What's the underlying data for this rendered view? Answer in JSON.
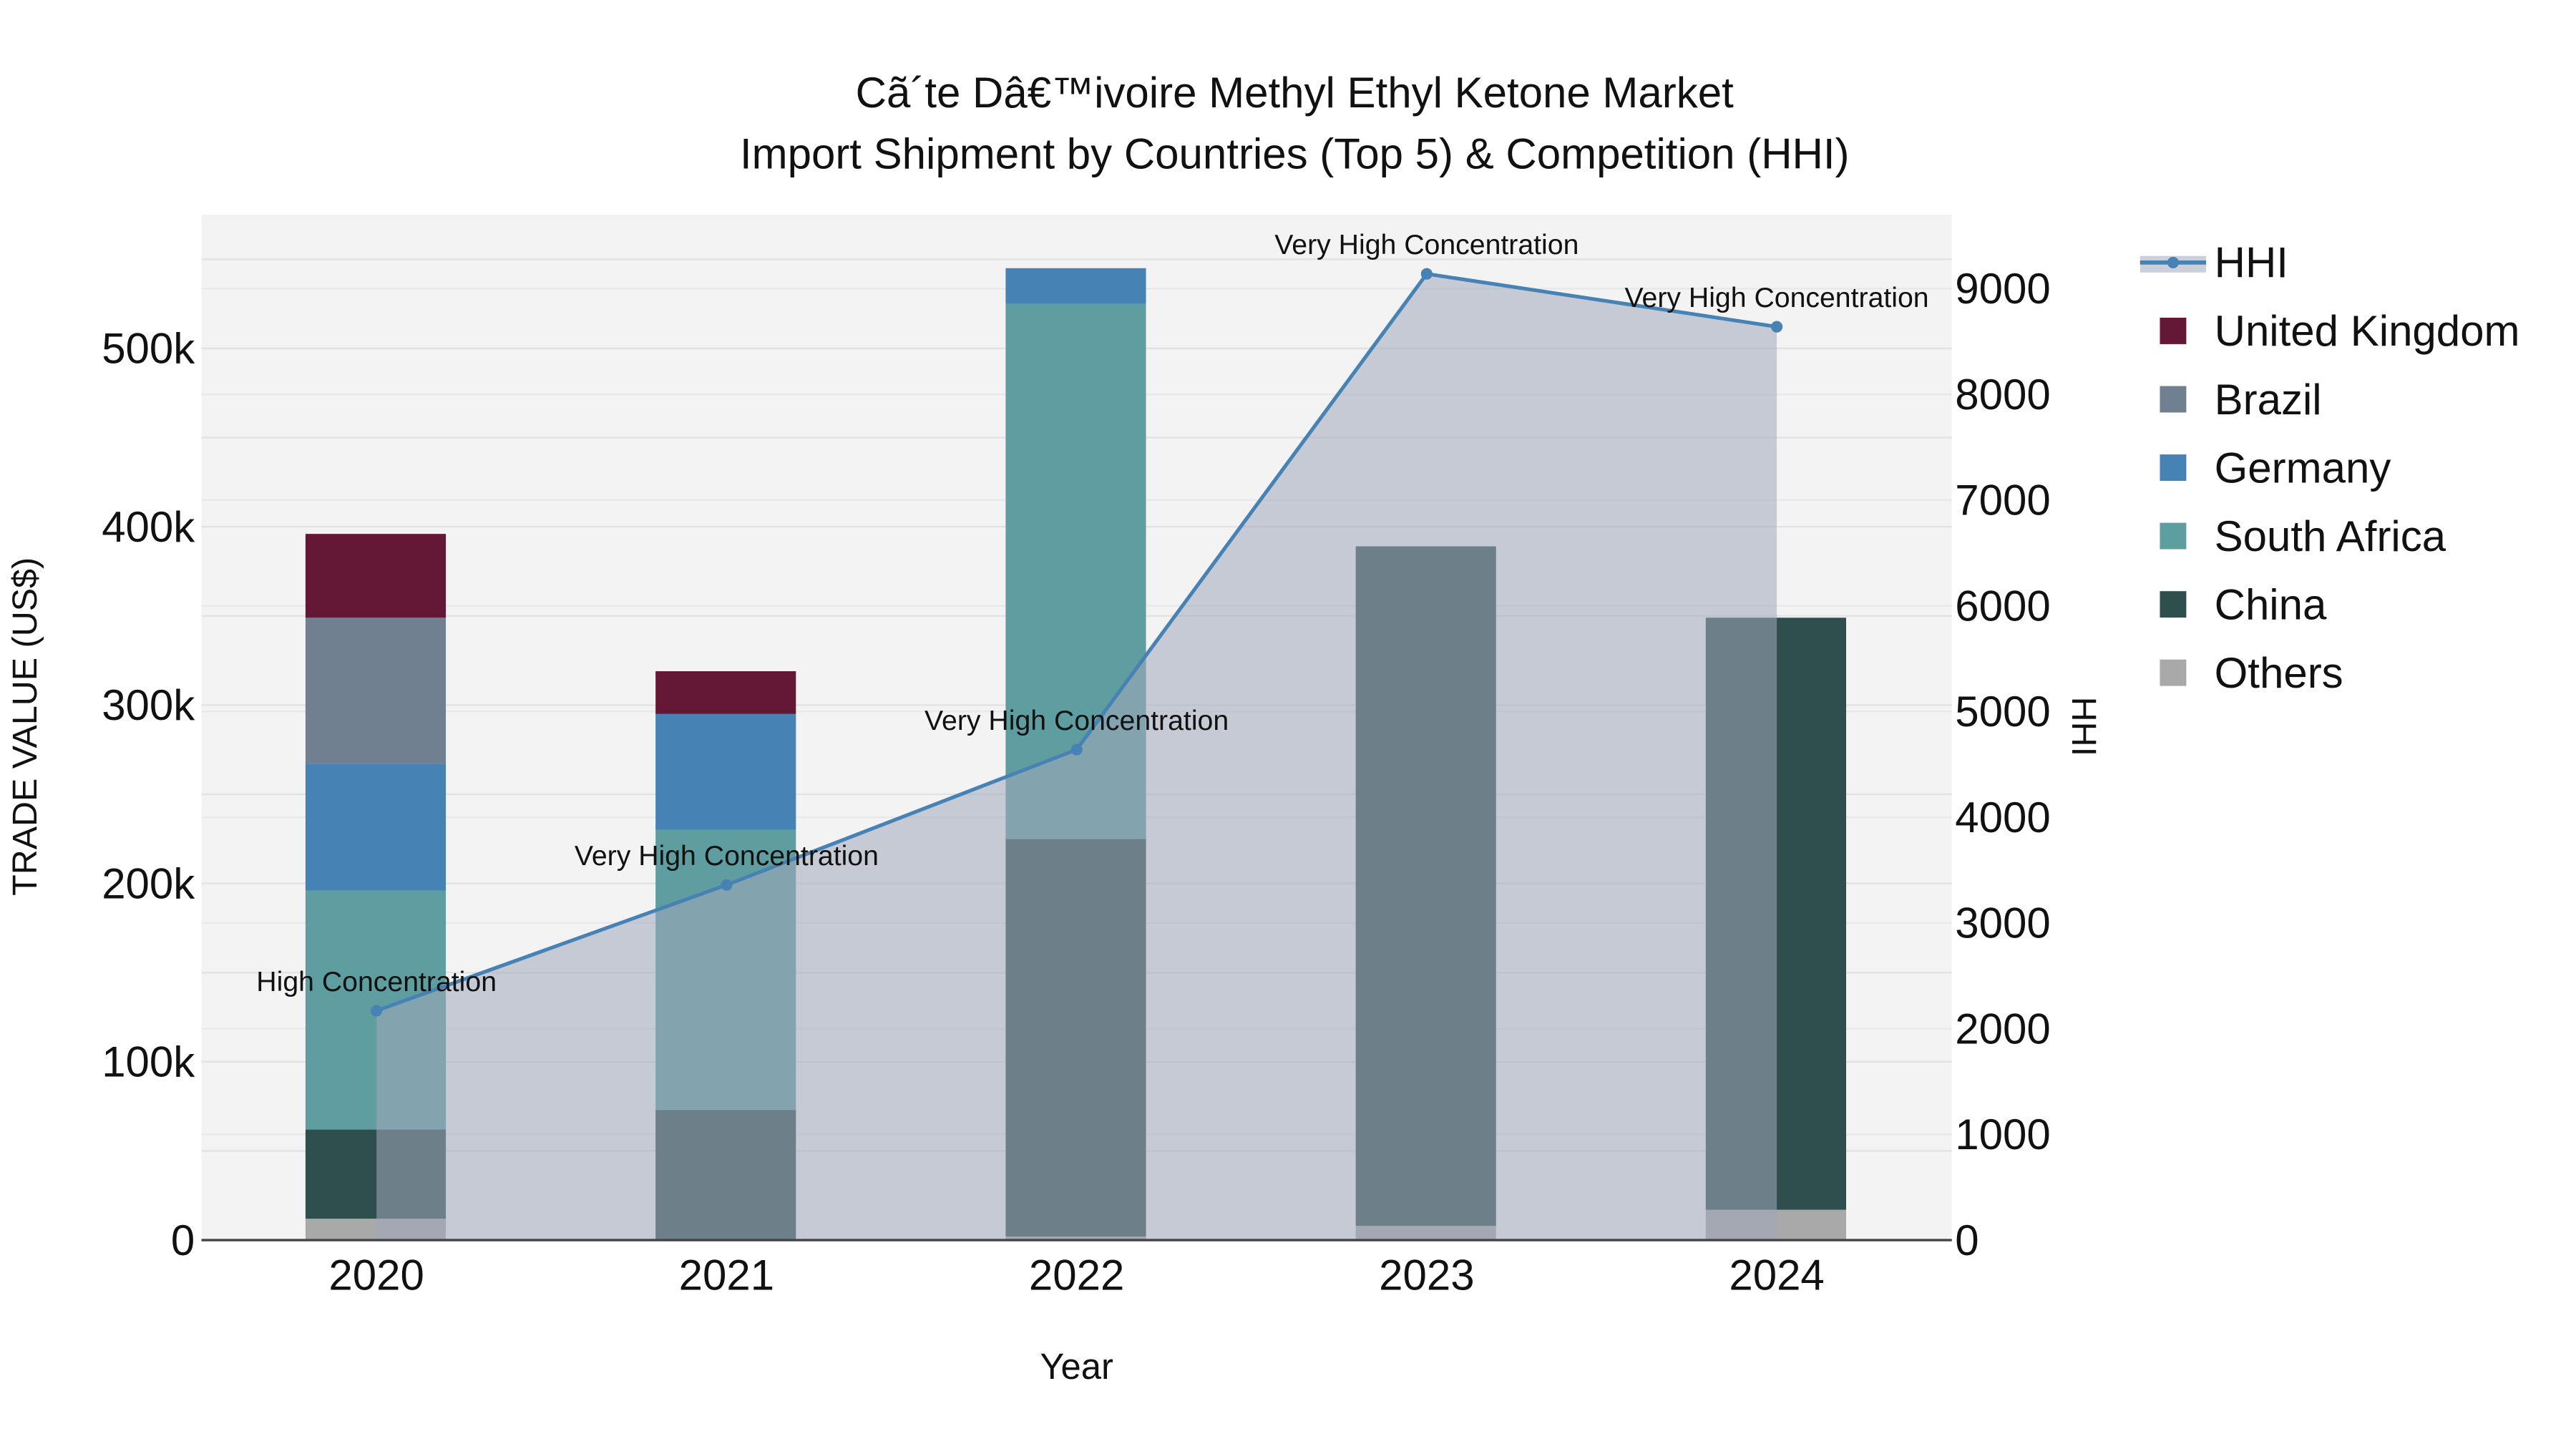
{
  "chart_data": {
    "type": "bar",
    "title": "Cã´te Dâ€™ivoire Methyl Ethyl Ketone Market",
    "subtitle": "Import Shipment by Countries (Top 5) & Competition (HHI)",
    "xlabel": "Year",
    "ylabel": "TRADE VALUE (US$)",
    "y2label": "HHI",
    "categories": [
      "2020",
      "2021",
      "2022",
      "2023",
      "2024"
    ],
    "ylim": [
      0,
      575000
    ],
    "y2lim": [
      0,
      9700
    ],
    "yticks": [
      0,
      100000,
      200000,
      300000,
      400000,
      500000
    ],
    "ytick_labels": [
      "0",
      "100k",
      "200k",
      "300k",
      "400k",
      "500k"
    ],
    "y2ticks": [
      0,
      1000,
      2000,
      3000,
      4000,
      5000,
      6000,
      7000,
      8000,
      9000
    ],
    "y2tick_labels": [
      "0",
      "1000",
      "2000",
      "3000",
      "4000",
      "5000",
      "6000",
      "7000",
      "8000",
      "9000"
    ],
    "stacked": true,
    "series": [
      {
        "name": "Others",
        "color": "#a9a9a9",
        "values": [
          12000,
          0,
          2000,
          8000,
          17000
        ]
      },
      {
        "name": "China",
        "color": "#2f4f4f",
        "values": [
          50000,
          73000,
          223000,
          381000,
          332000
        ]
      },
      {
        "name": "South Africa",
        "color": "#5f9ea0",
        "values": [
          134000,
          157000,
          300000,
          0,
          0
        ]
      },
      {
        "name": "Germany",
        "color": "#4682b4",
        "values": [
          71000,
          65000,
          20000,
          0,
          0
        ]
      },
      {
        "name": "Brazil",
        "color": "#708090",
        "values": [
          82000,
          0,
          0,
          0,
          0
        ]
      },
      {
        "name": "United Kingdom",
        "color": "#641835",
        "values": [
          47000,
          24000,
          0,
          0,
          0
        ]
      }
    ],
    "hhi": {
      "name": "HHI",
      "color": "#4682b4",
      "values": [
        2170,
        3360,
        4640,
        9140,
        8640
      ],
      "annotations": [
        "High Concentration",
        "Very High Concentration",
        "Very High Concentration",
        "Very High Concentration",
        "Very High Concentration"
      ]
    },
    "legend": {
      "placement": "right",
      "entries": [
        "HHI",
        "United Kingdom",
        "Brazil",
        "Germany",
        "South Africa",
        "China",
        "Others"
      ]
    },
    "grid": true
  }
}
